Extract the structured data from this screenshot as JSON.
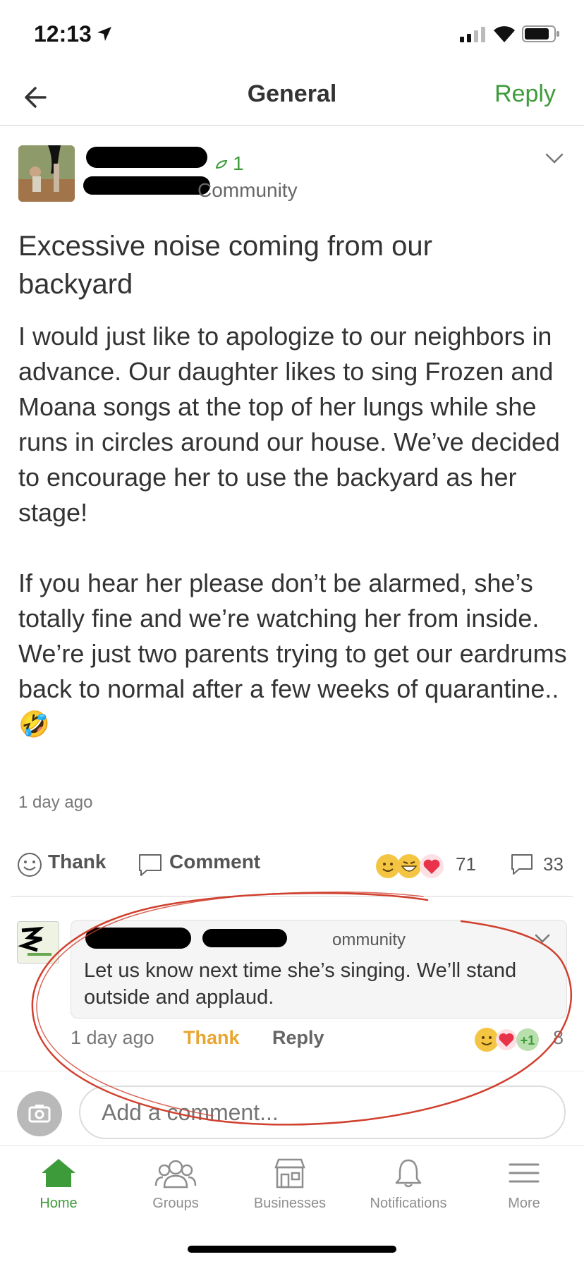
{
  "status": {
    "time": "12:13"
  },
  "nav": {
    "title": "General",
    "reply_label": "Reply"
  },
  "post": {
    "author_count": "1",
    "author_community": "Community",
    "title": "Excessive noise coming from our backyard",
    "body": "I would just like to apologize to our neighbors in advance. Our daughter likes to sing Frozen and Moana songs at the top of her lungs while she runs in circles around our house. We’ve decided to encourage her to use the backyard as her stage!\n\nIf you hear her please don’t be alarmed, she’s totally fine and we’re watching her from inside.\nWe’re just two parents trying to get our eardrums back to normal after a few weeks of quarantine.. 🤣",
    "time": "1 day ago",
    "thank_label": "Thank",
    "comment_label": "Comment",
    "reaction_count": "71",
    "comment_count": "33"
  },
  "comment": {
    "community": "ommunity",
    "text": "Let us know next time she’s singing. We’ll stand outside and applaud.",
    "time": "1 day ago",
    "thank_label": "Thank",
    "reply_label": "Reply",
    "plus_badge": "+1",
    "reaction_count": "8"
  },
  "compose": {
    "placeholder": "Add a comment..."
  },
  "tabs": [
    {
      "label": "Home",
      "icon": "home-icon"
    },
    {
      "label": "Groups",
      "icon": "groups-icon"
    },
    {
      "label": "Businesses",
      "icon": "businesses-icon"
    },
    {
      "label": "Notifications",
      "icon": "bell-icon"
    },
    {
      "label": "More",
      "icon": "menu-icon"
    }
  ],
  "colors": {
    "brand_green": "#3e9b3a",
    "thank_orange": "#e8a631",
    "annotation_red": "#d0402e"
  }
}
